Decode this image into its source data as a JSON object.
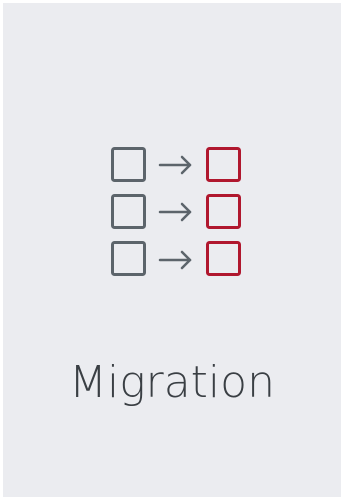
{
  "tile": {
    "title": "Migration"
  },
  "icon": {
    "name": "migration-icon",
    "source_color": "#5c646b",
    "target_color": "#b0172e",
    "rows": 3
  }
}
